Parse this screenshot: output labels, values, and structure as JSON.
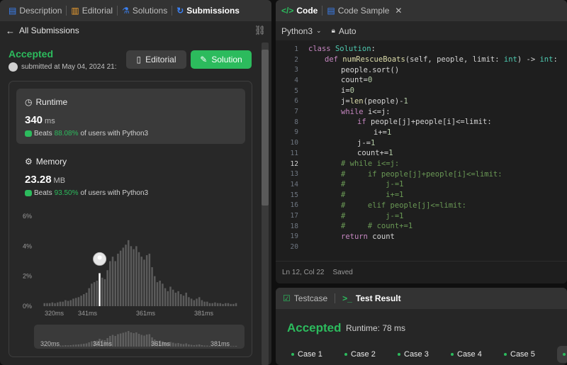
{
  "left_tabs": {
    "description": "Description",
    "editorial": "Editorial",
    "solutions": "Solutions",
    "submissions": "Submissions"
  },
  "subheader": {
    "back_label": "All Submissions"
  },
  "submission": {
    "status": "Accepted",
    "submitted_text": "submitted at May 04, 2024 21:",
    "editorial_btn": "Editorial",
    "solution_btn": "Solution"
  },
  "runtime": {
    "label": "Runtime",
    "value": "340",
    "unit": "ms",
    "beats_prefix": "Beats",
    "beats_pct": "88.08%",
    "beats_suffix": "of users with Python3"
  },
  "memory": {
    "label": "Memory",
    "value": "23.28",
    "unit": "MB",
    "beats_prefix": "Beats",
    "beats_pct": "93.50%",
    "beats_suffix": "of users with Python3"
  },
  "chart_data": {
    "type": "bar",
    "ylim": [
      0,
      6
    ],
    "yticks": [
      "0%",
      "2%",
      "4%",
      "6%"
    ],
    "xticks": [
      "320ms",
      "341ms",
      "361ms",
      "381ms"
    ],
    "highlight_index": 21,
    "values": [
      0.2,
      0.2,
      0.2,
      0.25,
      0.2,
      0.25,
      0.3,
      0.3,
      0.4,
      0.35,
      0.4,
      0.5,
      0.55,
      0.6,
      0.7,
      0.8,
      0.9,
      1.2,
      1.5,
      1.6,
      1.7,
      2.2,
      1.9,
      1.8,
      2.4,
      3.0,
      3.3,
      3.0,
      3.5,
      3.7,
      3.9,
      4.1,
      4.4,
      4.0,
      3.8,
      4.0,
      3.6,
      3.3,
      3.1,
      3.4,
      3.5,
      2.6,
      2.0,
      1.6,
      1.7,
      1.5,
      1.2,
      1.0,
      1.3,
      1.1,
      0.9,
      1.0,
      0.8,
      0.7,
      0.9,
      0.6,
      0.5,
      0.4,
      0.5,
      0.6,
      0.4,
      0.3,
      0.3,
      0.2,
      0.2,
      0.25,
      0.2,
      0.2,
      0.15,
      0.2,
      0.2,
      0.15,
      0.15,
      0.2
    ],
    "mini_xticks": [
      "320ms",
      "341ms",
      "361ms",
      "381ms"
    ]
  },
  "right_tabs": {
    "code": "Code",
    "code_sample": "Code Sample"
  },
  "editor": {
    "language": "Python3",
    "mode": "Auto",
    "status_pos": "Ln 12, Col 22",
    "status_saved": "Saved"
  },
  "code_lines": [
    {
      "n": "1",
      "indent": 0,
      "parts": [
        [
          "kw",
          "class "
        ],
        [
          "cls",
          "Solution"
        ],
        [
          "t",
          ":"
        ]
      ]
    },
    {
      "n": "2",
      "indent": 1,
      "parts": [
        [
          "kw",
          "def "
        ],
        [
          "fn",
          "numRescueBoats"
        ],
        [
          "t",
          "(self, people, limit: "
        ],
        [
          "cls",
          "int"
        ],
        [
          "t",
          ") -> "
        ],
        [
          "cls",
          "int"
        ],
        [
          "t",
          ":"
        ]
      ]
    },
    {
      "n": "3",
      "indent": 2,
      "parts": [
        [
          "t",
          "people.sort()"
        ]
      ]
    },
    {
      "n": "4",
      "indent": 2,
      "parts": [
        [
          "t",
          "count="
        ],
        [
          "num",
          "0"
        ]
      ]
    },
    {
      "n": "5",
      "indent": 2,
      "parts": [
        [
          "t",
          "i="
        ],
        [
          "num",
          "0"
        ]
      ]
    },
    {
      "n": "6",
      "indent": 2,
      "parts": [
        [
          "t",
          "j="
        ],
        [
          "fn",
          "len"
        ],
        [
          "t",
          "(people)-"
        ],
        [
          "num",
          "1"
        ]
      ]
    },
    {
      "n": "7",
      "indent": 2,
      "parts": [
        [
          "kw",
          "while "
        ],
        [
          "t",
          "i<=j:"
        ]
      ]
    },
    {
      "n": "8",
      "indent": 3,
      "parts": [
        [
          "kw",
          "if "
        ],
        [
          "t",
          "people[j]+people[i]<=limit:"
        ]
      ]
    },
    {
      "n": "9",
      "indent": 4,
      "parts": [
        [
          "t",
          "i+="
        ],
        [
          "num",
          "1"
        ]
      ]
    },
    {
      "n": "10",
      "indent": 3,
      "parts": [
        [
          "t",
          "j-="
        ],
        [
          "num",
          "1"
        ]
      ]
    },
    {
      "n": "11",
      "indent": 3,
      "parts": [
        [
          "t",
          "count+="
        ],
        [
          "num",
          "1"
        ]
      ]
    },
    {
      "n": "12",
      "indent": 2,
      "parts": [
        [
          "cm",
          "# while i<=j:"
        ]
      ]
    },
    {
      "n": "13",
      "indent": 2,
      "parts": [
        [
          "cm",
          "#     if people[j]+people[i]<=limit:"
        ]
      ]
    },
    {
      "n": "14",
      "indent": 2,
      "parts": [
        [
          "cm",
          "#         j-=1"
        ]
      ]
    },
    {
      "n": "15",
      "indent": 2,
      "parts": [
        [
          "cm",
          "#         i+=1"
        ]
      ]
    },
    {
      "n": "16",
      "indent": 2,
      "parts": [
        [
          "cm",
          "#     elif people[j]<=limit:"
        ]
      ]
    },
    {
      "n": "17",
      "indent": 2,
      "parts": [
        [
          "cm",
          "#         j-=1"
        ]
      ]
    },
    {
      "n": "18",
      "indent": 2,
      "parts": [
        [
          "cm",
          "#     # count+=1"
        ]
      ]
    },
    {
      "n": "19",
      "indent": 2,
      "parts": [
        [
          "kw",
          "return "
        ],
        [
          "t",
          "count"
        ]
      ]
    },
    {
      "n": "20",
      "indent": 0,
      "parts": []
    }
  ],
  "bottom_tabs": {
    "testcase": "Testcase",
    "test_result": "Test Result"
  },
  "result": {
    "status": "Accepted",
    "runtime": "Runtime: 78 ms",
    "cases": [
      "Case 1",
      "Case 2",
      "Case 3",
      "Case 4",
      "Case 5"
    ]
  },
  "colors": {
    "accent_green": "#2cbb5d",
    "submissions_icon": "#3b82f6",
    "editorial_icon": "#f0a030"
  }
}
